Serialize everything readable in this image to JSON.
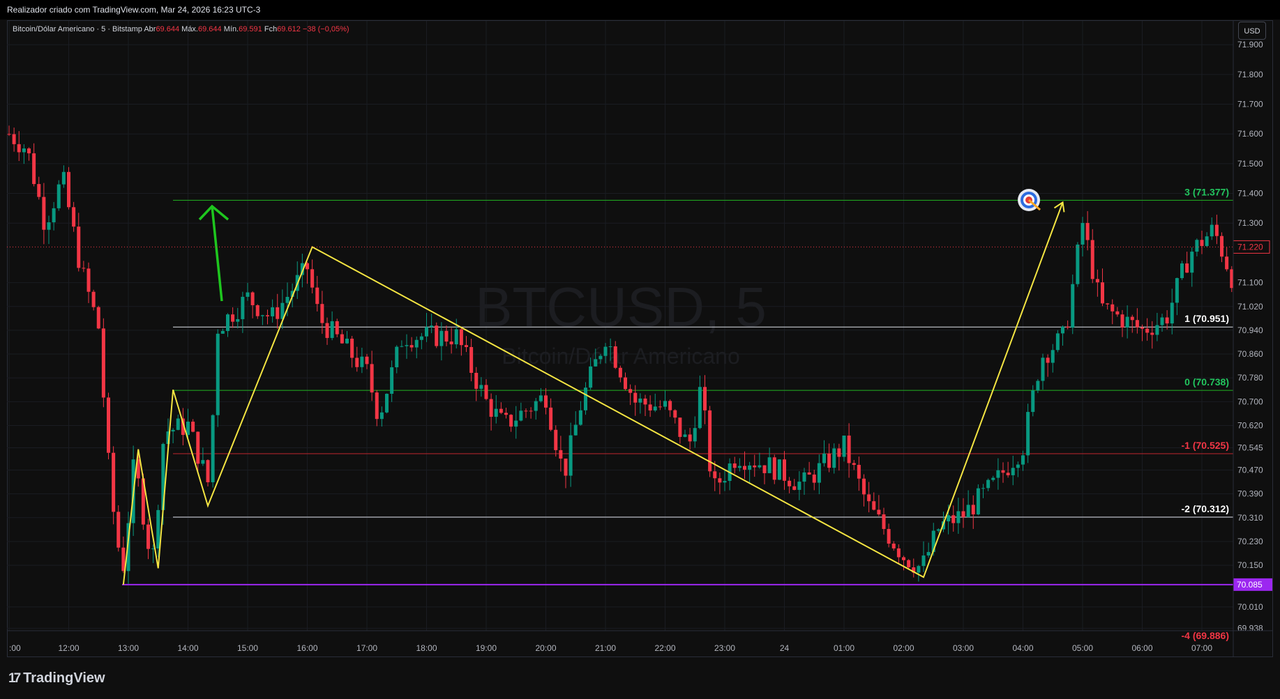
{
  "header": {
    "credit": "Realizador criado com TradingView.com, Mar 24, 2026 16:23 UTC-3"
  },
  "legend": {
    "symbol": "Bitcoin/Dólar Americano · 5 · Bitstamp",
    "open_label": "Abr",
    "open": "69.644",
    "high_label": "Máx.",
    "high": "69.644",
    "low_label": "Mín.",
    "low": "69.591",
    "close_label": "Fch",
    "close": "69.612",
    "change": "−38 (−0,05%)"
  },
  "currency_button": "USD",
  "watermark": {
    "ticker": "BTCUSD, 5",
    "name": "Bitcoin/Dólar Americano"
  },
  "brand": {
    "logo": "17",
    "name": "TradingView"
  },
  "colors": {
    "up": "#089981",
    "down": "#f23645",
    "zigzag": "#f4e542",
    "arrow": "#1ec61e",
    "support": "#9c27f0"
  },
  "icons": {
    "target": "target-icon",
    "logo": "tradingview-logo-icon"
  },
  "chart_data": {
    "type": "candlestick",
    "y_range": [
      69.93,
      71.98
    ],
    "x_ticks": [
      ":00",
      "12:00",
      "13:00",
      "14:00",
      "15:00",
      "16:00",
      "17:00",
      "18:00",
      "19:00",
      "20:00",
      "21:00",
      "22:00",
      "23:00",
      "24",
      "01:00",
      "02:00",
      "03:00",
      "04:00",
      "05:00",
      "06:00",
      "07:00"
    ],
    "y_ticks": [
      71.9,
      71.8,
      71.7,
      71.6,
      71.5,
      71.4,
      71.3,
      71.1,
      71.02,
      70.94,
      70.86,
      70.78,
      70.7,
      70.62,
      70.545,
      70.47,
      70.39,
      70.31,
      70.23,
      70.15,
      70.01,
      69.938
    ],
    "y_tick_labels": [
      "71.900",
      "71.800",
      "71.700",
      "71.600",
      "71.500",
      "71.400",
      "71.300",
      "71.100",
      "71.020",
      "70.940",
      "70.860",
      "70.780",
      "70.700",
      "70.620",
      "70.545",
      "70.470",
      "70.390",
      "70.310",
      "70.230",
      "70.150",
      "70.010",
      "69.938"
    ],
    "price_tag": {
      "value": 71.22,
      "label": "71.220"
    },
    "support_tag": {
      "value": 70.085,
      "label": "70.085"
    },
    "fib_levels": [
      {
        "label": "3 (71.377)",
        "value": 71.377,
        "color": "#22b322",
        "text_color": "#22c55e"
      },
      {
        "label": "1 (70.951)",
        "value": 70.951,
        "color": "#e0e3eb",
        "text_color": "#ffffff"
      },
      {
        "label": "0 (70.738)",
        "value": 70.738,
        "color": "#22b322",
        "text_color": "#22c55e"
      },
      {
        "label": "-1 (70.525)",
        "value": 70.525,
        "color": "#c0262e",
        "text_color": "#f23645"
      },
      {
        "label": "-2 (70.312)",
        "value": 70.312,
        "color": "#e0e3eb",
        "text_color": "#ffffff"
      },
      {
        "label": "-4 (69.886)",
        "value": 69.886,
        "color": "#c0262e",
        "text_color": "#f23645"
      }
    ],
    "zigzag": [
      {
        "t": "12:55",
        "p": 70.085
      },
      {
        "t": "13:10",
        "p": 70.54
      },
      {
        "t": "13:30",
        "p": 70.14
      },
      {
        "t": "13:45",
        "p": 70.74
      },
      {
        "t": "14:20",
        "p": 70.35
      },
      {
        "t": "16:05",
        "p": 71.22
      },
      {
        "t": "02:20",
        "p": 70.11
      },
      {
        "t": "04:40",
        "p": 71.37
      }
    ],
    "candle_samples": [
      {
        "t": "11:30",
        "o": 71.5,
        "c": 71.62,
        "h": 71.7,
        "l": 71.42
      },
      {
        "t": "11:45",
        "o": 71.55,
        "c": 71.28,
        "h": 71.62,
        "l": 71.2
      },
      {
        "t": "12:15",
        "o": 71.45,
        "c": 71.1,
        "h": 71.55,
        "l": 71.02
      },
      {
        "t": "12:45",
        "o": 70.8,
        "c": 70.2,
        "h": 70.85,
        "l": 70.1
      },
      {
        "t": "13:00",
        "o": 70.12,
        "c": 70.3,
        "h": 70.4,
        "l": 70.09
      },
      {
        "t": "14:15",
        "o": 70.55,
        "c": 70.42,
        "h": 70.6,
        "l": 70.38
      },
      {
        "t": "14:30",
        "o": 70.45,
        "c": 70.85,
        "h": 70.9,
        "l": 70.42
      },
      {
        "t": "15:00",
        "o": 70.98,
        "c": 71.1,
        "h": 71.15,
        "l": 70.95
      },
      {
        "t": "16:00",
        "o": 71.0,
        "c": 71.1,
        "h": 71.18,
        "l": 70.92
      },
      {
        "t": "17:00",
        "o": 70.85,
        "c": 70.65,
        "h": 70.9,
        "l": 70.58
      },
      {
        "t": "18:30",
        "o": 70.88,
        "c": 70.95,
        "h": 70.98,
        "l": 70.84
      },
      {
        "t": "19:00",
        "o": 70.8,
        "c": 70.55,
        "h": 70.85,
        "l": 70.5
      },
      {
        "t": "20:00",
        "o": 70.66,
        "c": 70.74,
        "h": 70.8,
        "l": 70.6
      },
      {
        "t": "20:30",
        "o": 70.55,
        "c": 70.42,
        "h": 70.6,
        "l": 70.38
      },
      {
        "t": "21:00",
        "o": 70.8,
        "c": 70.9,
        "h": 71.05,
        "l": 70.72
      },
      {
        "t": "22:00",
        "o": 70.7,
        "c": 70.6,
        "h": 70.74,
        "l": 70.52
      },
      {
        "t": "22:30",
        "o": 70.8,
        "c": 70.42,
        "h": 70.85,
        "l": 70.3
      },
      {
        "t": "23:30",
        "o": 70.45,
        "c": 70.52,
        "h": 70.58,
        "l": 70.4
      },
      {
        "t": "00:00",
        "o": 70.48,
        "c": 70.42,
        "h": 70.55,
        "l": 70.38
      },
      {
        "t": "01:00",
        "o": 70.55,
        "c": 70.6,
        "h": 70.7,
        "l": 70.5
      },
      {
        "t": "01:30",
        "o": 70.5,
        "c": 70.3,
        "h": 70.55,
        "l": 70.28
      },
      {
        "t": "02:00",
        "o": 70.32,
        "c": 70.12,
        "h": 70.38,
        "l": 70.1
      },
      {
        "t": "03:00",
        "o": 70.28,
        "c": 70.35,
        "h": 70.4,
        "l": 70.26
      },
      {
        "t": "04:00",
        "o": 70.55,
        "c": 70.8,
        "h": 70.85,
        "l": 70.52
      },
      {
        "t": "04:30",
        "o": 70.88,
        "c": 70.95,
        "h": 71.0,
        "l": 70.84
      },
      {
        "t": "05:00",
        "o": 71.32,
        "c": 71.05,
        "h": 71.38,
        "l": 71.0
      },
      {
        "t": "06:00",
        "o": 70.98,
        "c": 70.92,
        "h": 71.02,
        "l": 70.88
      },
      {
        "t": "07:00",
        "o": 71.3,
        "c": 71.25,
        "h": 71.35,
        "l": 71.2
      },
      {
        "t": "07:25",
        "o": 71.1,
        "c": 71.22,
        "h": 71.25,
        "l": 71.08
      }
    ]
  }
}
